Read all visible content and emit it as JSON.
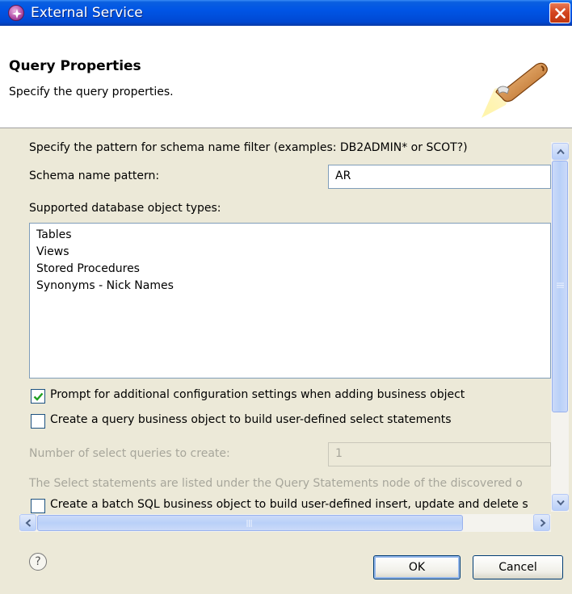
{
  "window": {
    "title": "External Service"
  },
  "header": {
    "title": "Query Properties",
    "description": "Specify the query properties."
  },
  "form": {
    "pattern_hint": "Specify the pattern for schema name filter (examples: DB2ADMIN* or SCOT?)",
    "schema_label": "Schema name pattern:",
    "schema_value": "AR",
    "object_types_label": "Supported database object types:",
    "object_types": [
      "Tables",
      "Views",
      "Stored Procedures",
      "Synonyms - Nick Names"
    ],
    "prompt_checkbox": {
      "label": "Prompt for additional configuration settings when adding business object",
      "checked": true
    },
    "query_bo_checkbox": {
      "label": "Create a query business object to build user-defined select statements",
      "checked": false
    },
    "num_queries_label": "Number of select queries to create:",
    "num_queries_value": "1",
    "select_statements_note": "The Select statements are listed under the Query Statements node of the discovered o",
    "batch_sql_checkbox": {
      "label": "Create a batch SQL business object to build user-defined insert, update and delete s",
      "checked": false
    }
  },
  "footer": {
    "help_glyph": "?",
    "ok_label": "OK",
    "cancel_label": "Cancel"
  },
  "colors": {
    "titlebar": "#0055e5",
    "dialog_bg": "#ece9d8",
    "header_bg": "#ffffff",
    "check_mark": "#21a121"
  }
}
